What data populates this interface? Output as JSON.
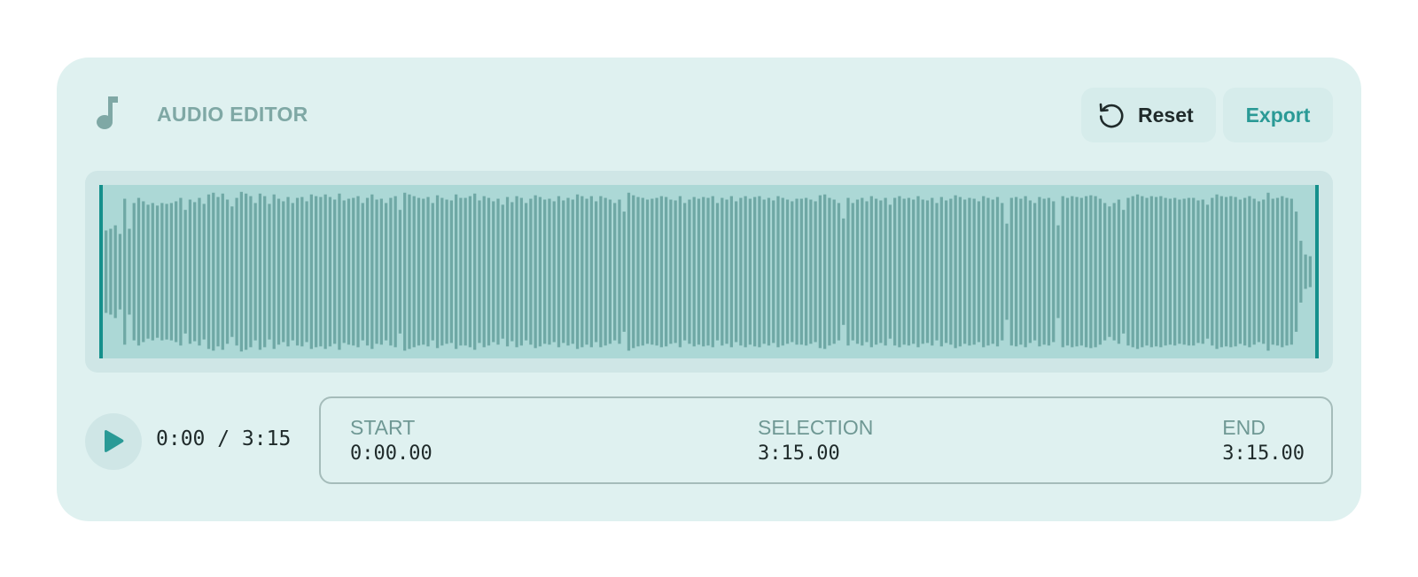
{
  "header": {
    "icon": "music-note-icon",
    "title": "AUDIO EDITOR",
    "reset_label": "Reset",
    "reset_icon": "reset-icon",
    "export_label": "Export"
  },
  "colors": {
    "accent": "#2a9a96",
    "card_bg": "#dff1f0",
    "waveform_bar": "#6fa8a5",
    "selection_bg": "#acd8d6",
    "handle": "#15908c"
  },
  "player": {
    "play_icon": "play-icon",
    "time": "0:00 / 3:15"
  },
  "range": {
    "start_label": "START",
    "start_value": "0:00.00",
    "selection_label": "SELECTION",
    "selection_value": "3:15.00",
    "end_label": "END",
    "end_value": "3:15.00"
  },
  "waveform": {
    "amplitudes": [
      0.48,
      0.5,
      0.54,
      0.44,
      0.85,
      0.5,
      0.8,
      0.86,
      0.82,
      0.78,
      0.8,
      0.77,
      0.8,
      0.79,
      0.8,
      0.82,
      0.86,
      0.72,
      0.84,
      0.81,
      0.86,
      0.79,
      0.9,
      0.92,
      0.87,
      0.91,
      0.84,
      0.76,
      0.86,
      0.93,
      0.91,
      0.88,
      0.8,
      0.91,
      0.88,
      0.79,
      0.9,
      0.85,
      0.82,
      0.87,
      0.8,
      0.86,
      0.87,
      0.82,
      0.9,
      0.88,
      0.87,
      0.9,
      0.87,
      0.84,
      0.91,
      0.83,
      0.85,
      0.86,
      0.88,
      0.8,
      0.86,
      0.9,
      0.84,
      0.85,
      0.8,
      0.86,
      0.88,
      0.72,
      0.92,
      0.9,
      0.88,
      0.86,
      0.85,
      0.87,
      0.8,
      0.89,
      0.86,
      0.84,
      0.83,
      0.9,
      0.86,
      0.86,
      0.88,
      0.91,
      0.83,
      0.88,
      0.86,
      0.82,
      0.85,
      0.78,
      0.87,
      0.81,
      0.88,
      0.86,
      0.8,
      0.85,
      0.89,
      0.87,
      0.84,
      0.85,
      0.82,
      0.88,
      0.83,
      0.86,
      0.84,
      0.9,
      0.88,
      0.85,
      0.88,
      0.82,
      0.88,
      0.86,
      0.84,
      0.8,
      0.84,
      0.7,
      0.92,
      0.89,
      0.87,
      0.86,
      0.84,
      0.85,
      0.86,
      0.88,
      0.87,
      0.84,
      0.83,
      0.88,
      0.8,
      0.84,
      0.87,
      0.85,
      0.87,
      0.86,
      0.88,
      0.8,
      0.86,
      0.84,
      0.88,
      0.82,
      0.86,
      0.88,
      0.85,
      0.87,
      0.88,
      0.84,
      0.86,
      0.83,
      0.88,
      0.86,
      0.84,
      0.82,
      0.85,
      0.85,
      0.86,
      0.84,
      0.82,
      0.89,
      0.9,
      0.86,
      0.84,
      0.8,
      0.62,
      0.86,
      0.8,
      0.84,
      0.86,
      0.82,
      0.88,
      0.85,
      0.83,
      0.86,
      0.78,
      0.86,
      0.88,
      0.85,
      0.86,
      0.84,
      0.88,
      0.84,
      0.83,
      0.86,
      0.8,
      0.87,
      0.83,
      0.85,
      0.89,
      0.87,
      0.84,
      0.86,
      0.85,
      0.82,
      0.88,
      0.86,
      0.84,
      0.87,
      0.8,
      0.56,
      0.86,
      0.87,
      0.85,
      0.88,
      0.83,
      0.8,
      0.87,
      0.85,
      0.86,
      0.82,
      0.54,
      0.88,
      0.86,
      0.88,
      0.87,
      0.86,
      0.88,
      0.89,
      0.88,
      0.85,
      0.8,
      0.76,
      0.8,
      0.84,
      0.72,
      0.86,
      0.88,
      0.9,
      0.88,
      0.86,
      0.88,
      0.87,
      0.88,
      0.86,
      0.85,
      0.86,
      0.84,
      0.85,
      0.86,
      0.86,
      0.83,
      0.84,
      0.78,
      0.86,
      0.9,
      0.88,
      0.87,
      0.88,
      0.87,
      0.84,
      0.86,
      0.88,
      0.85,
      0.82,
      0.84,
      0.92,
      0.85,
      0.86,
      0.88,
      0.86,
      0.85,
      0.7,
      0.36,
      0.2,
      0.18
    ],
    "selection_start": 0.0,
    "selection_end": 1.0
  }
}
